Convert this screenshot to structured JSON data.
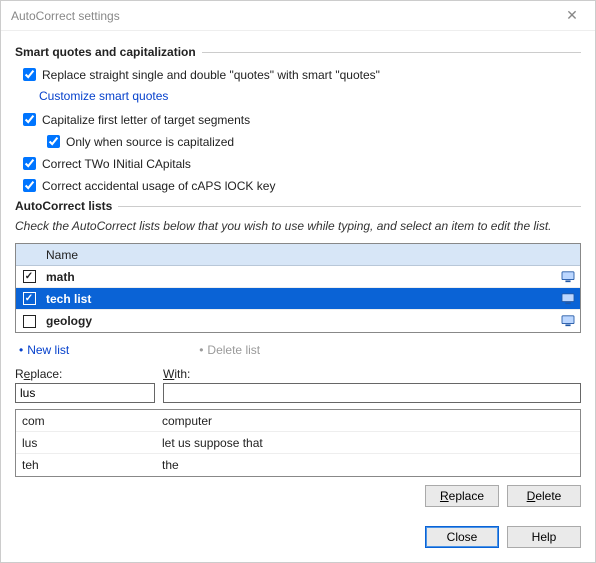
{
  "window": {
    "title": "AutoCorrect settings"
  },
  "group1": {
    "heading": "Smart quotes and capitalization",
    "opt_replace_quotes": "Replace straight single and double \"quotes\" with smart \"quotes\"",
    "link_customize": "Customize smart quotes",
    "opt_capitalize": "Capitalize first letter of target segments",
    "opt_only_when": "Only when source is capitalized",
    "opt_two_initial": "Correct TWo INitial CApitals",
    "opt_caps_lock": "Correct accidental usage of cAPS lOCK key"
  },
  "group2": {
    "heading": "AutoCorrect lists",
    "description": "Check the AutoCorrect lists below that you wish to use while typing, and select an item to edit the list.",
    "col_name": "Name",
    "items": [
      {
        "name": "math",
        "checked": true,
        "selected": false
      },
      {
        "name": "tech list",
        "checked": true,
        "selected": true
      },
      {
        "name": "geology",
        "checked": false,
        "selected": false
      }
    ],
    "action_new": "New list",
    "action_delete": "Delete list"
  },
  "edit": {
    "label_replace_pre": "R",
    "label_replace_ul": "e",
    "label_replace_post": "place:",
    "label_with_ul": "W",
    "label_with_post": "ith:",
    "value_replace": "lus",
    "value_with": "",
    "rows": [
      {
        "k": "com",
        "v": "computer"
      },
      {
        "k": "lus",
        "v": "let us suppose that"
      },
      {
        "k": "teh",
        "v": "the"
      }
    ],
    "btn_replace_ul": "R",
    "btn_replace_post": "eplace",
    "btn_delete_ul": "D",
    "btn_delete_post": "elete"
  },
  "footer": {
    "btn_close": "Close",
    "btn_help": "Help"
  }
}
